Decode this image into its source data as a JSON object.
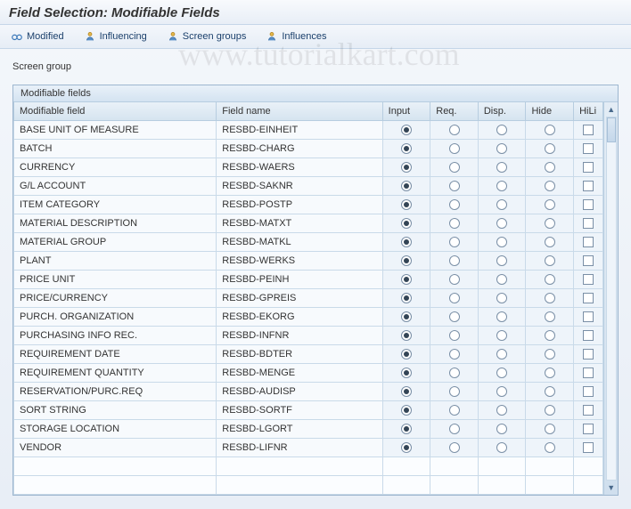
{
  "title": "Field Selection: Modifiable Fields",
  "watermark": "www.tutorialkart.com",
  "toolbar": {
    "modified": "Modified",
    "influencing": "Influencing",
    "screen_groups": "Screen groups",
    "influences": "Influences"
  },
  "screen_group_label": "Screen group",
  "table": {
    "title": "Modifiable fields",
    "headers": {
      "label": "Modifiable field",
      "name": "Field name",
      "input": "Input",
      "req": "Req.",
      "disp": "Disp.",
      "hide": "Hide",
      "hili": "HiLi"
    },
    "rows": [
      {
        "label": "BASE UNIT OF MEASURE",
        "name": "RESBD-EINHEIT",
        "sel": "input"
      },
      {
        "label": "BATCH",
        "name": "RESBD-CHARG",
        "sel": "input"
      },
      {
        "label": "CURRENCY",
        "name": "RESBD-WAERS",
        "sel": "input"
      },
      {
        "label": "G/L ACCOUNT",
        "name": "RESBD-SAKNR",
        "sel": "input"
      },
      {
        "label": "ITEM CATEGORY",
        "name": "RESBD-POSTP",
        "sel": "input"
      },
      {
        "label": "MATERIAL DESCRIPTION",
        "name": "RESBD-MATXT",
        "sel": "input"
      },
      {
        "label": "MATERIAL GROUP",
        "name": "RESBD-MATKL",
        "sel": "input"
      },
      {
        "label": "PLANT",
        "name": "RESBD-WERKS",
        "sel": "input"
      },
      {
        "label": "PRICE UNIT",
        "name": "RESBD-PEINH",
        "sel": "input"
      },
      {
        "label": "PRICE/CURRENCY",
        "name": "RESBD-GPREIS",
        "sel": "input"
      },
      {
        "label": "PURCH. ORGANIZATION",
        "name": "RESBD-EKORG",
        "sel": "input"
      },
      {
        "label": "PURCHASING INFO REC.",
        "name": "RESBD-INFNR",
        "sel": "input"
      },
      {
        "label": "REQUIREMENT DATE",
        "name": "RESBD-BDTER",
        "sel": "input"
      },
      {
        "label": "REQUIREMENT QUANTITY",
        "name": "RESBD-MENGE",
        "sel": "input"
      },
      {
        "label": "RESERVATION/PURC.REQ",
        "name": "RESBD-AUDISP",
        "sel": "input"
      },
      {
        "label": "SORT STRING",
        "name": "RESBD-SORTF",
        "sel": "input"
      },
      {
        "label": "STORAGE LOCATION",
        "name": "RESBD-LGORT",
        "sel": "input"
      },
      {
        "label": "VENDOR",
        "name": "RESBD-LIFNR",
        "sel": "input"
      }
    ]
  }
}
